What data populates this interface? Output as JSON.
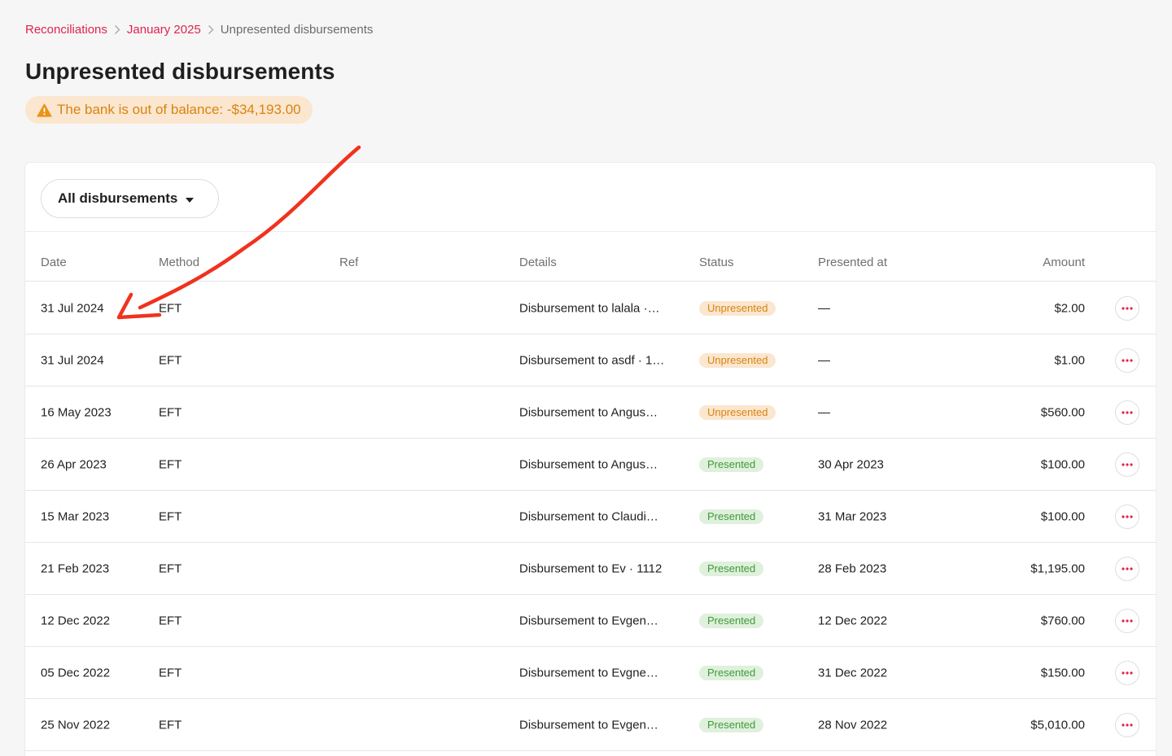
{
  "breadcrumb": {
    "items": [
      "Reconciliations",
      "January 2025"
    ],
    "current": "Unpresented disbursements"
  },
  "page": {
    "title": "Unpresented disbursements",
    "warning": "The bank is out of balance: -$34,193.00"
  },
  "filter": {
    "label": "All disbursements"
  },
  "table": {
    "columns": [
      "Date",
      "Method",
      "Ref",
      "Details",
      "Status",
      "Presented at",
      "Amount"
    ],
    "rows": [
      {
        "date": "31 Jul 2024",
        "method": "EFT",
        "ref": "",
        "details": "Disbursement to lalala ·…",
        "status": "Unpresented",
        "presented_at": "—",
        "amount": "$2.00"
      },
      {
        "date": "31 Jul 2024",
        "method": "EFT",
        "ref": "",
        "details": "Disbursement to asdf · 1…",
        "status": "Unpresented",
        "presented_at": "—",
        "amount": "$1.00"
      },
      {
        "date": "16 May 2023",
        "method": "EFT",
        "ref": "",
        "details": "Disbursement to Angus…",
        "status": "Unpresented",
        "presented_at": "—",
        "amount": "$560.00"
      },
      {
        "date": "26 Apr 2023",
        "method": "EFT",
        "ref": "",
        "details": "Disbursement to Angus…",
        "status": "Presented",
        "presented_at": "30 Apr 2023",
        "amount": "$100.00"
      },
      {
        "date": "15 Mar 2023",
        "method": "EFT",
        "ref": "",
        "details": "Disbursement to Claudi…",
        "status": "Presented",
        "presented_at": "31 Mar 2023",
        "amount": "$100.00"
      },
      {
        "date": "21 Feb 2023",
        "method": "EFT",
        "ref": "",
        "details": "Disbursement to Ev · 1112",
        "status": "Presented",
        "presented_at": "28 Feb 2023",
        "amount": "$1,195.00"
      },
      {
        "date": "12 Dec 2022",
        "method": "EFT",
        "ref": "",
        "details": "Disbursement to Evgen…",
        "status": "Presented",
        "presented_at": "12 Dec 2022",
        "amount": "$760.00"
      },
      {
        "date": "05 Dec 2022",
        "method": "EFT",
        "ref": "",
        "details": "Disbursement to Evgne…",
        "status": "Presented",
        "presented_at": "31 Dec 2022",
        "amount": "$150.00"
      },
      {
        "date": "25 Nov 2022",
        "method": "EFT",
        "ref": "",
        "details": "Disbursement to Evgen…",
        "status": "Presented",
        "presented_at": "28 Nov 2022",
        "amount": "$5,010.00"
      }
    ]
  },
  "icons": {
    "breadcrumb_separator": "chevron-right-icon",
    "warning": "warning-triangle-icon",
    "dropdown": "caret-down-icon",
    "row_actions": "more-horizontal-icon",
    "annotation": "red-arrow-annotation"
  },
  "colors": {
    "accent": "#e0234e",
    "warning_bg": "#fbe6cf",
    "warning_text": "#d88410",
    "success_bg": "#dff0dc",
    "success_text": "#3f9a3a",
    "annotation": "#f0321e"
  }
}
